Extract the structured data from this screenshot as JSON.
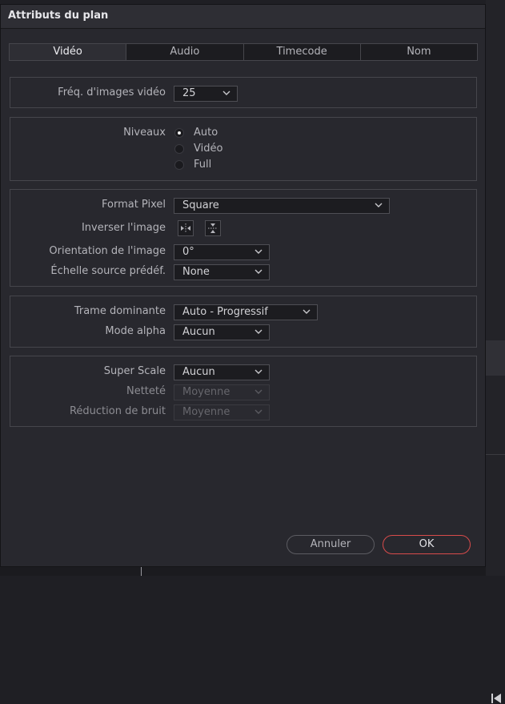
{
  "dialog": {
    "title": "Attributs du plan"
  },
  "tabs": [
    {
      "label": "Vidéo",
      "active": true
    },
    {
      "label": "Audio",
      "active": false
    },
    {
      "label": "Timecode",
      "active": false
    },
    {
      "label": "Nom",
      "active": false
    }
  ],
  "frame_rate": {
    "label": "Fréq. d'images vidéo",
    "value": "25"
  },
  "levels": {
    "label": "Niveaux",
    "options": [
      "Auto",
      "Vidéo",
      "Full"
    ],
    "selected": "Auto"
  },
  "pixel": {
    "format_label": "Format Pixel",
    "format_value": "Square",
    "flip_label": "Inverser l'image",
    "orientation_label": "Orientation de l'image",
    "orientation_value": "0°",
    "scale_label": "Échelle source prédéf.",
    "scale_value": "None"
  },
  "field": {
    "dominance_label": "Trame dominante",
    "dominance_value": "Auto - Progressif",
    "alpha_label": "Mode alpha",
    "alpha_value": "Aucun"
  },
  "superscale": {
    "label": "Super Scale",
    "value": "Aucun",
    "sharpness_label": "Netteté",
    "sharpness_value": "Moyenne",
    "noise_label": "Réduction de bruit",
    "noise_value": "Moyenne"
  },
  "buttons": {
    "cancel": "Annuler",
    "ok": "OK"
  },
  "icons": {
    "chevron": "chevron-down-icon",
    "flip_h": "flip-horizontal-icon",
    "flip_v": "flip-vertical-icon",
    "collapse": "collapse-left-icon"
  },
  "colors": {
    "accent_ok": "#d84b4b",
    "background": "#28282e"
  }
}
